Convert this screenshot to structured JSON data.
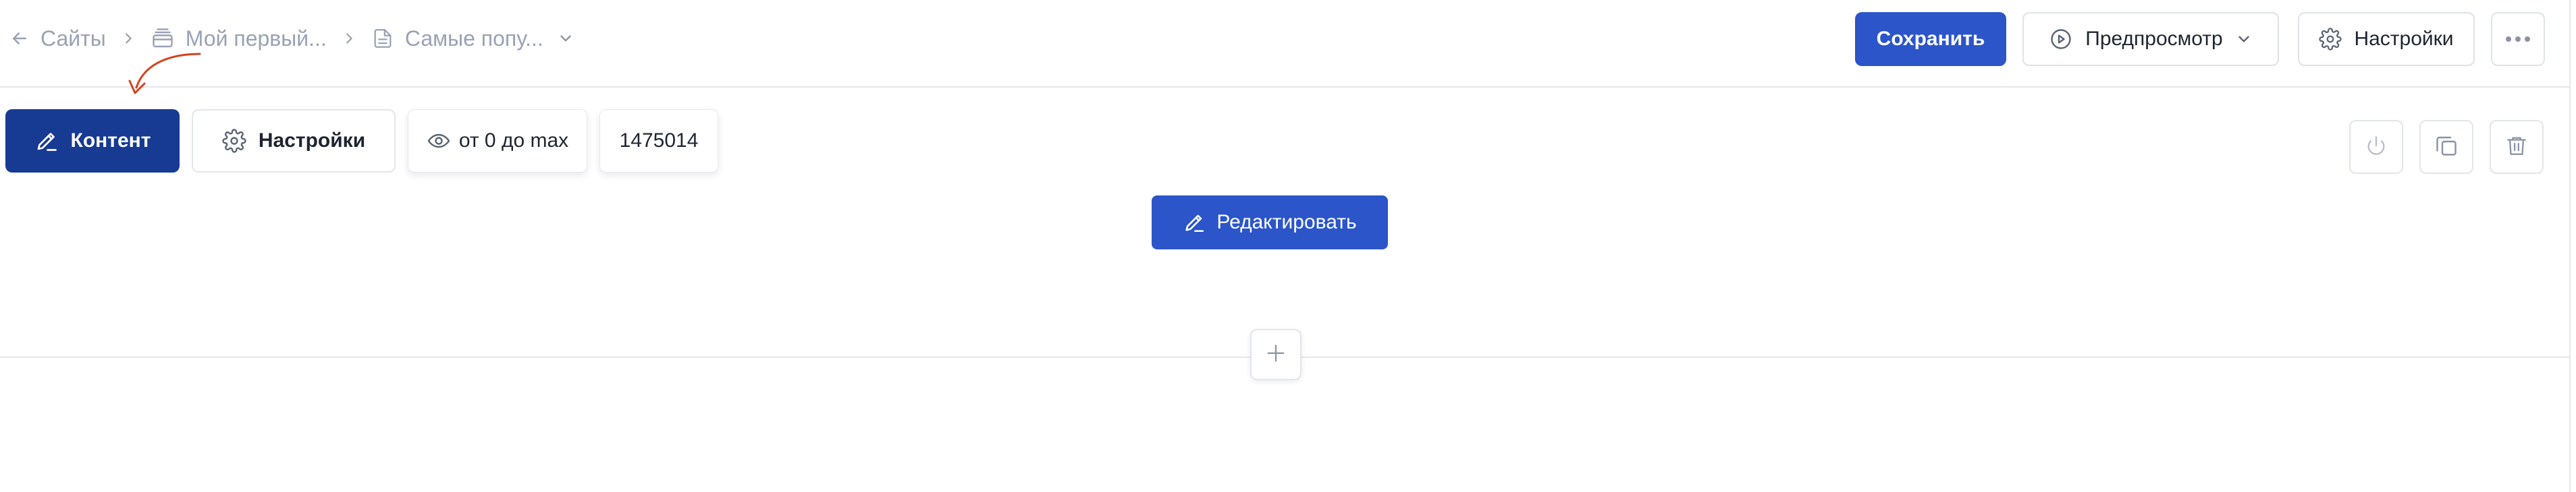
{
  "breadcrumb": {
    "items": [
      {
        "label": "Сайты",
        "icon": "arrow-left-icon"
      },
      {
        "label": "Мой первый...",
        "icon": "stack-icon"
      },
      {
        "label": "Самые попу...",
        "icon": "document-icon"
      }
    ]
  },
  "header": {
    "save_label": "Сохранить",
    "preview_label": "Предпросмотр",
    "settings_label": "Настройки"
  },
  "block_toolbar": {
    "content_label": "Контент",
    "settings_label": "Настройки",
    "visibility_label": "от 0 до max",
    "block_id": "1475014"
  },
  "block": {
    "edit_label": "Редактировать"
  },
  "colors": {
    "primary": "#2b55c9",
    "active_tab": "#173a93",
    "muted_text": "#99a1b3",
    "border": "#e2e5ea",
    "annotation_arrow": "#d14420"
  }
}
